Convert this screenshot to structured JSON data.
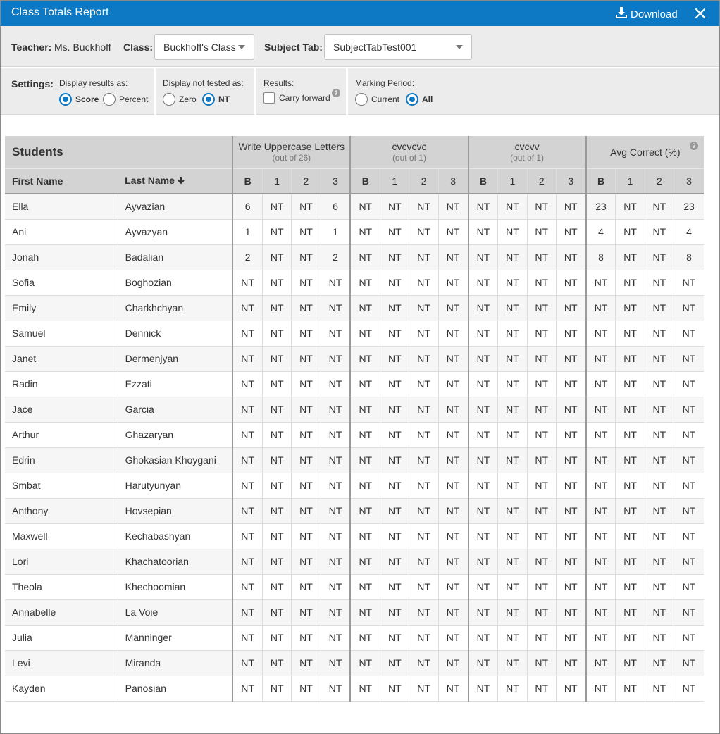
{
  "window": {
    "title": "Class Totals Report",
    "download_label": "Download"
  },
  "header": {
    "teacher_label": "Teacher:",
    "teacher_value": "Ms. Buckhoff",
    "class_label": "Class:",
    "class_value": "Buckhoff's Class",
    "subject_label": "Subject Tab:",
    "subject_value": "SubjectTabTest001"
  },
  "settings": {
    "label": "Settings:",
    "display_results": {
      "label": "Display results as:",
      "options": [
        "Score",
        "Percent"
      ],
      "selected": "Score"
    },
    "not_tested": {
      "label": "Display not tested as:",
      "options": [
        "Zero",
        "NT"
      ],
      "selected": "NT"
    },
    "results": {
      "label": "Results:",
      "carry_forward_label": "Carry forward",
      "carry_forward_checked": false
    },
    "marking_period": {
      "label": "Marking Period:",
      "options": [
        "Current",
        "All"
      ],
      "selected": "All"
    }
  },
  "table": {
    "students_label": "Students",
    "first_name_label": "First Name",
    "last_name_label": "Last Name",
    "groups": [
      {
        "title": "Write Uppercase Letters",
        "sub": "(out of 26)"
      },
      {
        "title": "cvcvcvc",
        "sub": "(out of 1)"
      },
      {
        "title": "cvcvv",
        "sub": "(out of 1)"
      },
      {
        "title": "Avg Correct (%)",
        "sub": ""
      }
    ],
    "periods": [
      "B",
      "1",
      "2",
      "3"
    ],
    "rows": [
      {
        "first": "Ella",
        "last": "Ayvazian",
        "values": [
          "6",
          "NT",
          "NT",
          "6",
          "NT",
          "NT",
          "NT",
          "NT",
          "NT",
          "NT",
          "NT",
          "NT",
          "23",
          "NT",
          "NT",
          "23"
        ]
      },
      {
        "first": "Ani",
        "last": "Ayvazyan",
        "values": [
          "1",
          "NT",
          "NT",
          "1",
          "NT",
          "NT",
          "NT",
          "NT",
          "NT",
          "NT",
          "NT",
          "NT",
          "4",
          "NT",
          "NT",
          "4"
        ]
      },
      {
        "first": "Jonah",
        "last": "Badalian",
        "values": [
          "2",
          "NT",
          "NT",
          "2",
          "NT",
          "NT",
          "NT",
          "NT",
          "NT",
          "NT",
          "NT",
          "NT",
          "8",
          "NT",
          "NT",
          "8"
        ]
      },
      {
        "first": "Sofia",
        "last": "Boghozian",
        "values": [
          "NT",
          "NT",
          "NT",
          "NT",
          "NT",
          "NT",
          "NT",
          "NT",
          "NT",
          "NT",
          "NT",
          "NT",
          "NT",
          "NT",
          "NT",
          "NT"
        ]
      },
      {
        "first": "Emily",
        "last": "Charkhchyan",
        "values": [
          "NT",
          "NT",
          "NT",
          "NT",
          "NT",
          "NT",
          "NT",
          "NT",
          "NT",
          "NT",
          "NT",
          "NT",
          "NT",
          "NT",
          "NT",
          "NT"
        ]
      },
      {
        "first": "Samuel",
        "last": "Dennick",
        "values": [
          "NT",
          "NT",
          "NT",
          "NT",
          "NT",
          "NT",
          "NT",
          "NT",
          "NT",
          "NT",
          "NT",
          "NT",
          "NT",
          "NT",
          "NT",
          "NT"
        ]
      },
      {
        "first": "Janet",
        "last": "Dermenjyan",
        "values": [
          "NT",
          "NT",
          "NT",
          "NT",
          "NT",
          "NT",
          "NT",
          "NT",
          "NT",
          "NT",
          "NT",
          "NT",
          "NT",
          "NT",
          "NT",
          "NT"
        ]
      },
      {
        "first": "Radin",
        "last": "Ezzati",
        "values": [
          "NT",
          "NT",
          "NT",
          "NT",
          "NT",
          "NT",
          "NT",
          "NT",
          "NT",
          "NT",
          "NT",
          "NT",
          "NT",
          "NT",
          "NT",
          "NT"
        ]
      },
      {
        "first": "Jace",
        "last": "Garcia",
        "values": [
          "NT",
          "NT",
          "NT",
          "NT",
          "NT",
          "NT",
          "NT",
          "NT",
          "NT",
          "NT",
          "NT",
          "NT",
          "NT",
          "NT",
          "NT",
          "NT"
        ]
      },
      {
        "first": "Arthur",
        "last": "Ghazaryan",
        "values": [
          "NT",
          "NT",
          "NT",
          "NT",
          "NT",
          "NT",
          "NT",
          "NT",
          "NT",
          "NT",
          "NT",
          "NT",
          "NT",
          "NT",
          "NT",
          "NT"
        ]
      },
      {
        "first": "Edrin",
        "last": "Ghokasian Khoygani",
        "values": [
          "NT",
          "NT",
          "NT",
          "NT",
          "NT",
          "NT",
          "NT",
          "NT",
          "NT",
          "NT",
          "NT",
          "NT",
          "NT",
          "NT",
          "NT",
          "NT"
        ]
      },
      {
        "first": "Smbat",
        "last": "Harutyunyan",
        "values": [
          "NT",
          "NT",
          "NT",
          "NT",
          "NT",
          "NT",
          "NT",
          "NT",
          "NT",
          "NT",
          "NT",
          "NT",
          "NT",
          "NT",
          "NT",
          "NT"
        ]
      },
      {
        "first": "Anthony",
        "last": "Hovsepian",
        "values": [
          "NT",
          "NT",
          "NT",
          "NT",
          "NT",
          "NT",
          "NT",
          "NT",
          "NT",
          "NT",
          "NT",
          "NT",
          "NT",
          "NT",
          "NT",
          "NT"
        ]
      },
      {
        "first": "Maxwell",
        "last": "Kechabashyan",
        "values": [
          "NT",
          "NT",
          "NT",
          "NT",
          "NT",
          "NT",
          "NT",
          "NT",
          "NT",
          "NT",
          "NT",
          "NT",
          "NT",
          "NT",
          "NT",
          "NT"
        ]
      },
      {
        "first": "Lori",
        "last": "Khachatoorian",
        "values": [
          "NT",
          "NT",
          "NT",
          "NT",
          "NT",
          "NT",
          "NT",
          "NT",
          "NT",
          "NT",
          "NT",
          "NT",
          "NT",
          "NT",
          "NT",
          "NT"
        ]
      },
      {
        "first": "Theola",
        "last": "Khechoomian",
        "values": [
          "NT",
          "NT",
          "NT",
          "NT",
          "NT",
          "NT",
          "NT",
          "NT",
          "NT",
          "NT",
          "NT",
          "NT",
          "NT",
          "NT",
          "NT",
          "NT"
        ]
      },
      {
        "first": "Annabelle",
        "last": "La Voie",
        "values": [
          "NT",
          "NT",
          "NT",
          "NT",
          "NT",
          "NT",
          "NT",
          "NT",
          "NT",
          "NT",
          "NT",
          "NT",
          "NT",
          "NT",
          "NT",
          "NT"
        ]
      },
      {
        "first": "Julia",
        "last": "Manninger",
        "values": [
          "NT",
          "NT",
          "NT",
          "NT",
          "NT",
          "NT",
          "NT",
          "NT",
          "NT",
          "NT",
          "NT",
          "NT",
          "NT",
          "NT",
          "NT",
          "NT"
        ]
      },
      {
        "first": "Levi",
        "last": "Miranda",
        "values": [
          "NT",
          "NT",
          "NT",
          "NT",
          "NT",
          "NT",
          "NT",
          "NT",
          "NT",
          "NT",
          "NT",
          "NT",
          "NT",
          "NT",
          "NT",
          "NT"
        ]
      },
      {
        "first": "Kayden",
        "last": "Panosian",
        "values": [
          "NT",
          "NT",
          "NT",
          "NT",
          "NT",
          "NT",
          "NT",
          "NT",
          "NT",
          "NT",
          "NT",
          "NT",
          "NT",
          "NT",
          "NT",
          "NT"
        ]
      }
    ]
  },
  "colors": {
    "titlebar": "#0d79c4",
    "accent": "#0d79c4",
    "header_bg": "#d3d3d3",
    "settings_bg": "#ececec"
  }
}
